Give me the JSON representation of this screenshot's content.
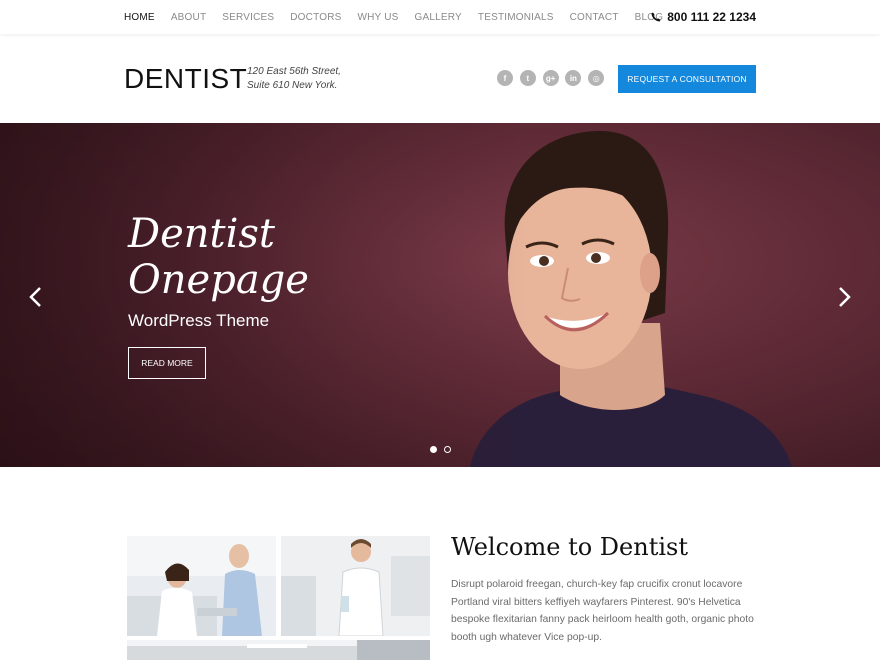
{
  "nav": {
    "items": [
      {
        "label": "HOME",
        "active": true
      },
      {
        "label": "ABOUT",
        "active": false
      },
      {
        "label": "SERVICES",
        "active": false
      },
      {
        "label": "DOCTORS",
        "active": false
      },
      {
        "label": "WHY US",
        "active": false
      },
      {
        "label": "GALLERY",
        "active": false
      },
      {
        "label": "TESTIMONIALS",
        "active": false
      },
      {
        "label": "CONTACT",
        "active": false
      },
      {
        "label": "BLOG",
        "active": false
      }
    ],
    "phone": "800 111 22 1234",
    "phone_icon": "phone-icon"
  },
  "header": {
    "logo": "DENTIST",
    "address_line1": "120 East 56th Street,",
    "address_line2": "Suite 610 New York.",
    "socials": [
      {
        "icon": "facebook-icon",
        "glyph": "f"
      },
      {
        "icon": "twitter-icon",
        "glyph": "t"
      },
      {
        "icon": "google-plus-icon",
        "glyph": "g+"
      },
      {
        "icon": "linkedin-icon",
        "glyph": "in"
      },
      {
        "icon": "instagram-icon",
        "glyph": "◎"
      }
    ],
    "cta_label": "REQUEST A CONSULTATION"
  },
  "hero": {
    "title_line1": "Dentist",
    "title_line2": "Onepage",
    "subtitle": "WordPress Theme",
    "button_label": "READ MORE",
    "slides": 2,
    "active_slide": 1
  },
  "welcome": {
    "title": "Welcome to Dentist",
    "text": "Disrupt polaroid freegan, church-key fap crucifix cronut locavore Portland viral bitters keffiyeh wayfarers Pinterest. 90's Helvetica bespoke flexitarian fanny pack heirloom health goth, organic photo booth ugh whatever Vice pop-up."
  },
  "colors": {
    "accent": "#1488dc",
    "hero_bg": "#5e2a36",
    "social_gray": "#b4b4b4"
  }
}
